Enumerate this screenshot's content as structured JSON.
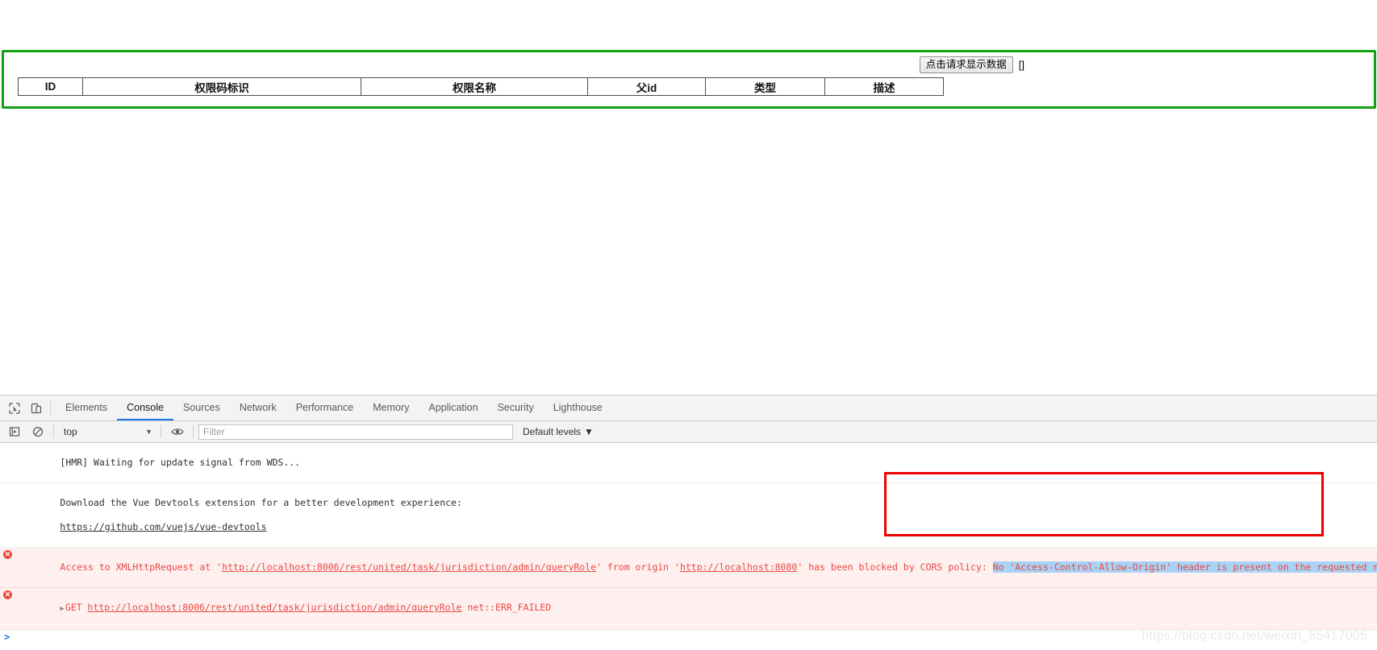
{
  "page": {
    "request_button_label": "点击请求显示数据",
    "data_output": "[]",
    "table": {
      "headers": [
        "ID",
        "权限码标识",
        "权限名称",
        "父id",
        "类型",
        "描述"
      ],
      "rows": []
    },
    "highlight_border_color": "#12a012"
  },
  "devtools": {
    "tabs": [
      {
        "label": "Elements",
        "active": false
      },
      {
        "label": "Console",
        "active": true
      },
      {
        "label": "Sources",
        "active": false
      },
      {
        "label": "Network",
        "active": false
      },
      {
        "label": "Performance",
        "active": false
      },
      {
        "label": "Memory",
        "active": false
      },
      {
        "label": "Application",
        "active": false
      },
      {
        "label": "Security",
        "active": false
      },
      {
        "label": "Lighthouse",
        "active": false
      }
    ],
    "toolbar": {
      "context_value": "top",
      "filter_placeholder": "Filter",
      "filter_value": "",
      "levels_label": "Default levels",
      "caret": "▼"
    },
    "console": {
      "messages": [
        {
          "type": "info",
          "text": "[HMR] Waiting for update signal from WDS...",
          "line2": "",
          "link": ""
        },
        {
          "type": "info",
          "text": "Download the Vue Devtools extension for a better development experience:",
          "link": "https://github.com/vuejs/vue-devtools"
        },
        {
          "type": "error",
          "prefix": "Access to XMLHttpRequest at '",
          "url": "http://localhost:8006/rest/united/task/jurisdiction/admin/queryRole",
          "mid": "' from origin '",
          "origin": "http://localhost:8080",
          "mid2": "' has been blocked by CORS policy: ",
          "selected": "No 'Access-Control-Allow-Origin' header is present on the requested resource.",
          "suffix": ""
        },
        {
          "type": "error",
          "method": "GET",
          "url": "http://localhost:8006/rest/united/task/jurisdiction/admin/queryRole",
          "status": "net::ERR_FAILED",
          "expandable": true
        }
      ],
      "prompt_symbol": ">",
      "prompt_value": ""
    },
    "icons": {
      "inspect": "inspect-element-icon",
      "device": "device-toolbar-icon",
      "execute": "execute-snippet-icon",
      "clear": "clear-console-icon",
      "eye": "live-expression-icon"
    }
  },
  "watermark": "https://blog.csdn.net/weixin_55417005",
  "colors": {
    "accent": "#1a73e8",
    "error": "#e8493f",
    "error_bg": "#fff0f0",
    "annotation": "#ee0000",
    "success_border": "#12a012",
    "selection": "#a8d3f7"
  }
}
